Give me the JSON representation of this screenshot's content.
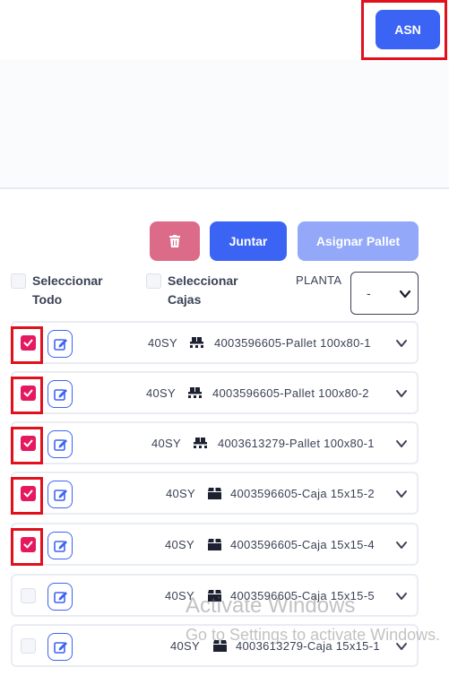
{
  "header": {
    "asn_label": "ASN"
  },
  "actions": {
    "delete_icon": "trash-icon",
    "join_label": "Juntar",
    "assign_label": "Asignar Pallet"
  },
  "selectors": {
    "select_all_line1": "Seleccionar",
    "select_all_line2": "Todo",
    "select_boxes_line1": "Seleccionar",
    "select_boxes_line2": "Cajas",
    "planta_label": "PLANTA",
    "planta_value": "-"
  },
  "rows": [
    {
      "code": "40SY",
      "desc": "4003596605-Pallet 100x80-1",
      "icon": "pallet-icon",
      "checked": true
    },
    {
      "code": "40SY",
      "desc": "4003596605-Pallet 100x80-2",
      "icon": "pallet-icon",
      "checked": true
    },
    {
      "code": "40SY",
      "desc": "4003613279-Pallet 100x80-1",
      "icon": "pallet-icon",
      "checked": true
    },
    {
      "code": "40SY",
      "desc": "4003596605-Caja 15x15-2",
      "icon": "box-icon",
      "checked": true
    },
    {
      "code": "40SY",
      "desc": "4003596605-Caja 15x15-4",
      "icon": "box-icon",
      "checked": true
    },
    {
      "code": "40SY",
      "desc": "4003596605-Caja 15x15-5",
      "icon": "box-icon",
      "checked": false
    },
    {
      "code": "40SY",
      "desc": "4003613279-Caja 15x15-1",
      "icon": "box-icon",
      "checked": false
    }
  ],
  "watermark": {
    "line1": "Activate Windows",
    "line2": "Go to Settings to activate Windows."
  },
  "colors": {
    "primary": "#3c64f4",
    "danger": "#dc6b8a",
    "disabled": "#93a8f8",
    "check": "#e5195f",
    "highlight": "#e0101c"
  }
}
